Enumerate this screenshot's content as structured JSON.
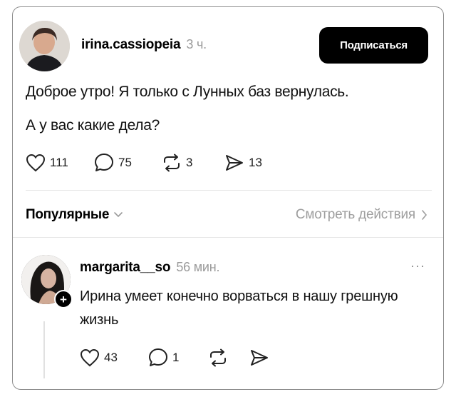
{
  "post": {
    "username": "irina.cassiopeia",
    "time": "3 ч.",
    "subscribe_label": "Подписаться",
    "line1": "Доброе утро! Я только с Лунных баз вернулась.",
    "line2": "А у вас какие дела?",
    "likes": "111",
    "comments": "75",
    "reposts": "3",
    "shares": "13"
  },
  "filter": {
    "sort_label": "Популярные",
    "view_actions_label": "Смотреть действия"
  },
  "reply": {
    "username": "margarita__so",
    "time": "56 мин.",
    "more": "···",
    "plus": "+",
    "text": "Ирина умеет конечно ворваться в нашу грешную жизнь",
    "likes": "43",
    "comments": "1"
  },
  "icons": {
    "heart": "heart-icon",
    "comment": "comment-icon",
    "repost": "repost-icon",
    "share": "share-icon",
    "chevron_down": "chevron-down-icon",
    "chevron_right": "chevron-right-icon"
  }
}
